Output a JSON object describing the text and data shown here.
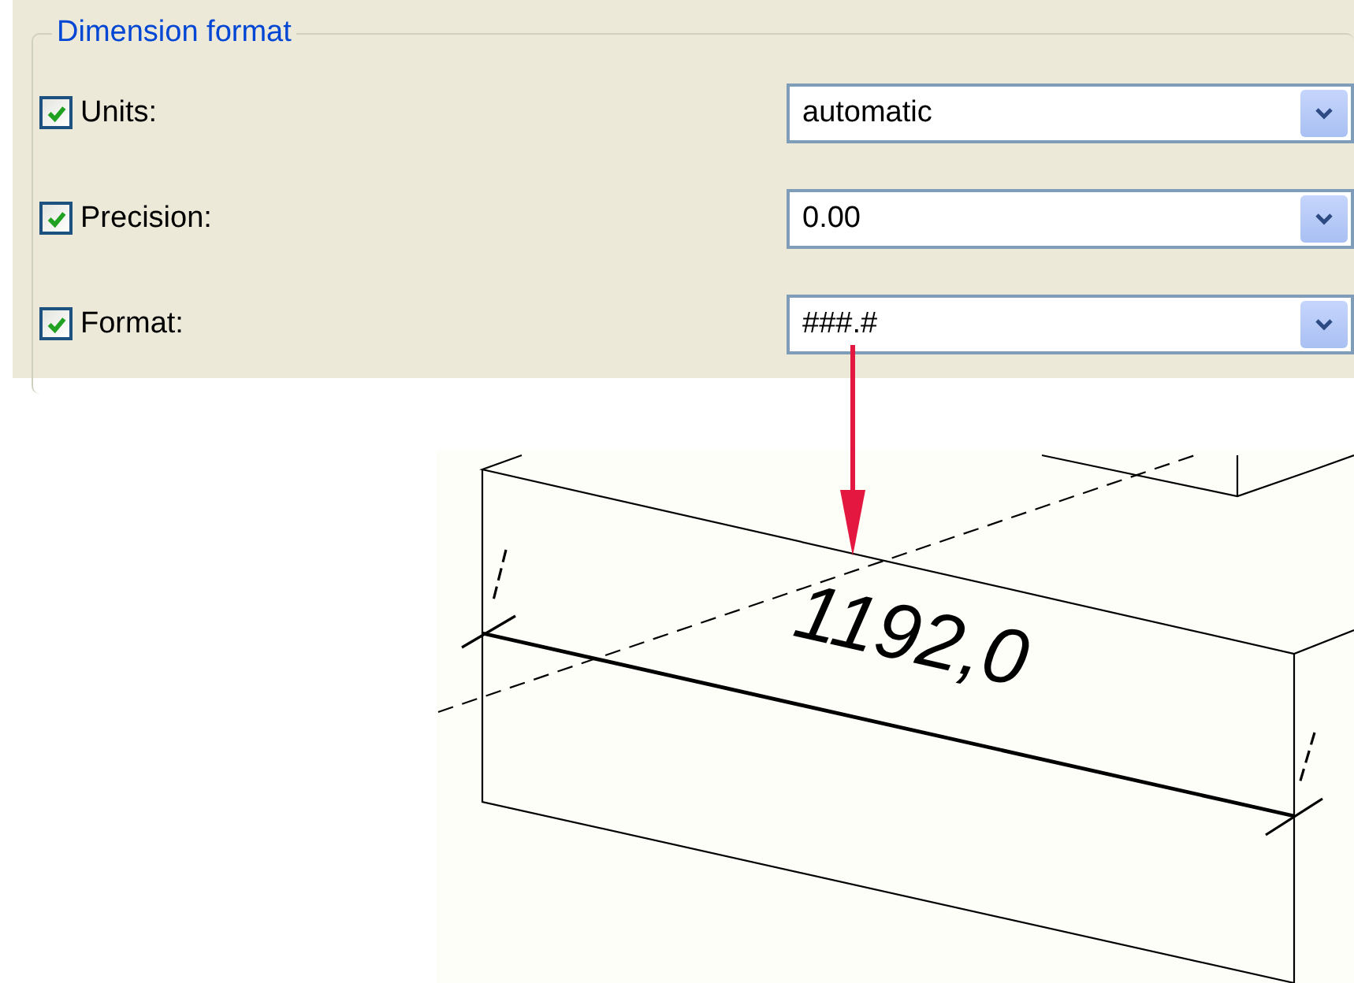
{
  "group": {
    "title": "Dimension format",
    "rows": [
      {
        "label": "Units:",
        "checked": true,
        "value": "automatic"
      },
      {
        "label": "Precision:",
        "checked": true,
        "value": "0.00"
      },
      {
        "label": "Format:",
        "checked": true,
        "value": "###.#"
      }
    ]
  },
  "drawing": {
    "dimension": "1192,0"
  }
}
